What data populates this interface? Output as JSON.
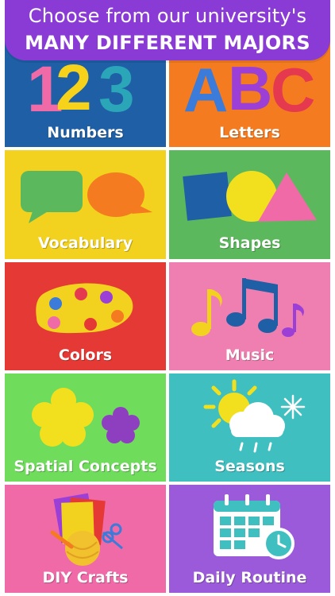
{
  "banner": {
    "line1": "Choose from our university's",
    "line2": "MANY DIFFERENT MAJORS"
  },
  "tiles": [
    {
      "label": "Numbers",
      "color": "#1f5fa6",
      "icon": "numbers-123-icon"
    },
    {
      "label": "Letters",
      "color": "#f47b20",
      "icon": "letters-abc-icon"
    },
    {
      "label": "Vocabulary",
      "color": "#f2d21e",
      "icon": "speech-bubbles-icon"
    },
    {
      "label": "Shapes",
      "color": "#5cb85c",
      "icon": "shapes-icon"
    },
    {
      "label": "Colors",
      "color": "#e53935",
      "icon": "paint-palette-icon"
    },
    {
      "label": "Music",
      "color": "#ef7fb0",
      "icon": "music-notes-icon"
    },
    {
      "label": "Spatial Concepts",
      "color": "#6fdc5c",
      "icon": "flowers-icon"
    },
    {
      "label": "Seasons",
      "color": "#3fbfc0",
      "icon": "weather-icon"
    },
    {
      "label": "DIY Crafts",
      "color": "#f06aa8",
      "icon": "crafts-icon"
    },
    {
      "label": "Daily Routine",
      "color": "#9b5ad9",
      "icon": "calendar-icon"
    }
  ],
  "icon_text": {
    "numbers": "123",
    "letters": "ABC"
  }
}
